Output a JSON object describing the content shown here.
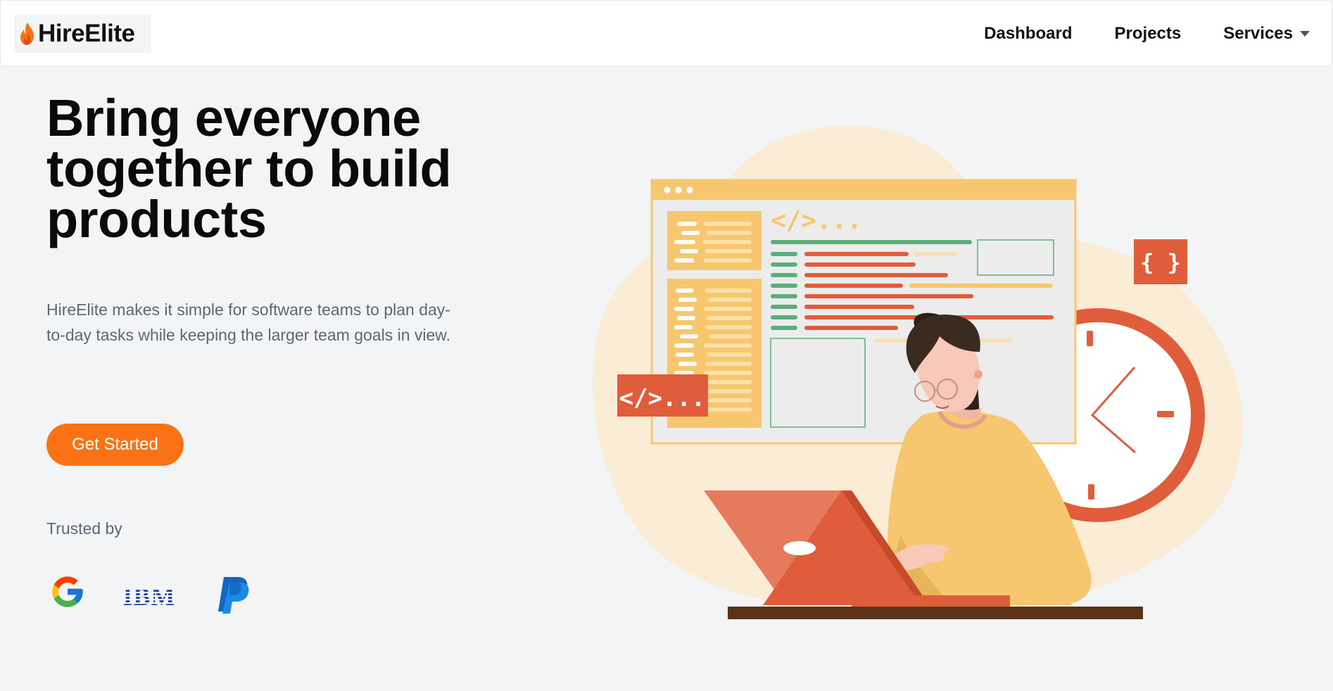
{
  "brand": {
    "name": "HireElite",
    "icon": "flame-icon",
    "accent": "#f97316"
  },
  "nav": {
    "dashboard": "Dashboard",
    "projects": "Projects",
    "services": "Services"
  },
  "hero": {
    "title": "Bring everyone together to build products",
    "description": "HireElite makes it simple for software teams to plan day-to-day tasks while keeping the larger team goals in view.",
    "cta": "Get Started"
  },
  "trusted": {
    "label": "Trusted by",
    "logos": [
      "google-logo",
      "ibm-logo",
      "paypal-logo"
    ],
    "ibm_text": "IBM"
  },
  "illustration": {
    "code_tag": "</>...",
    "braces": "{ }",
    "colors": {
      "blob": "#fbecd6",
      "orange_red": "#e05d3b",
      "yellow": "#f6c76e",
      "green": "#5aaf7a"
    }
  }
}
